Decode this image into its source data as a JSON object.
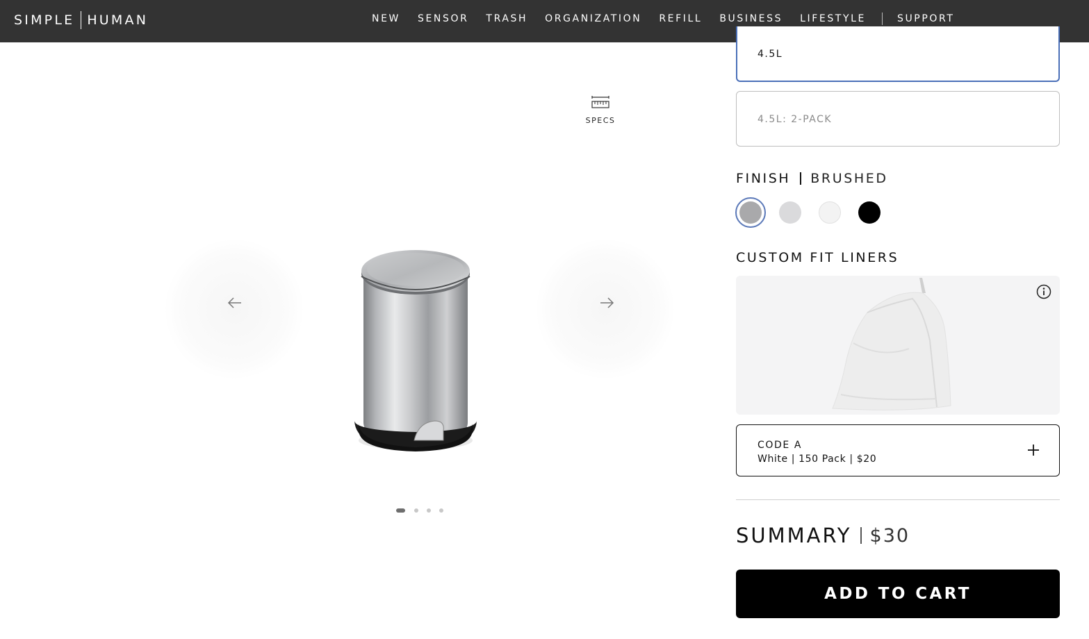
{
  "header": {
    "logo": {
      "left": "SIMPLE",
      "right": "HUMAN"
    },
    "nav": [
      "NEW",
      "SENSOR",
      "TRASH",
      "ORGANIZATION",
      "REFILL",
      "BUSINESS",
      "LIFESTYLE"
    ],
    "support": "SUPPORT"
  },
  "gallery": {
    "specs_label": "SPECS",
    "slide_count": 4,
    "active_slide": 1
  },
  "size_options": [
    {
      "label": "4.5L",
      "selected": true
    },
    {
      "label": "4.5L: 2-PACK",
      "selected": false
    }
  ],
  "finish": {
    "title": "FINISH",
    "value": "BRUSHED",
    "swatches": [
      {
        "color": "#a9a9ab",
        "selected": true
      },
      {
        "color": "#dadadc",
        "selected": false
      },
      {
        "color": "#f3f3f3",
        "selected": false
      },
      {
        "color": "#000000",
        "selected": false
      }
    ]
  },
  "liners": {
    "title": "CUSTOM FIT LINERS",
    "code_title": "CODE A",
    "code_sub": "White | 150 Pack | $20"
  },
  "summary": {
    "label": "SUMMARY",
    "price": "$30"
  },
  "cta": {
    "label": "ADD TO CART"
  },
  "colors": {
    "nav_bg": "#333333",
    "accent": "#4a6fb8",
    "cta_bg": "#000000"
  }
}
